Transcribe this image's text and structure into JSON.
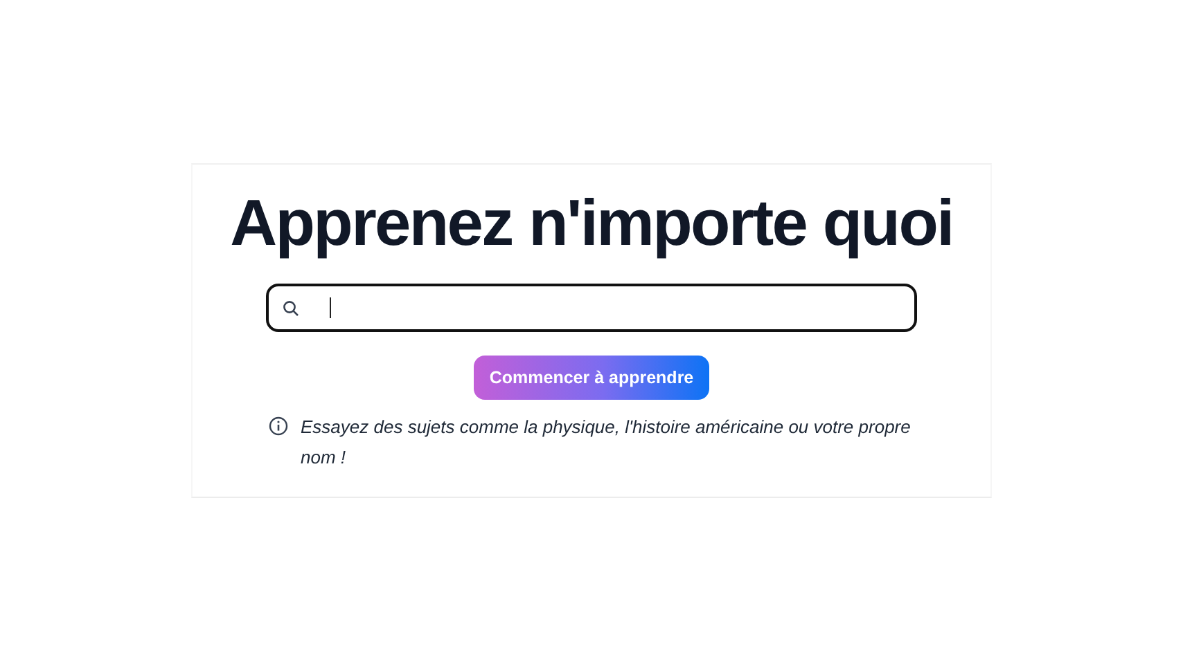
{
  "heading": "Apprenez n'importe quoi",
  "button": "Commencer à apprendre",
  "hint": "Essayez des sujets comme la physique, l'histoire américaine ou votre propre nom !"
}
